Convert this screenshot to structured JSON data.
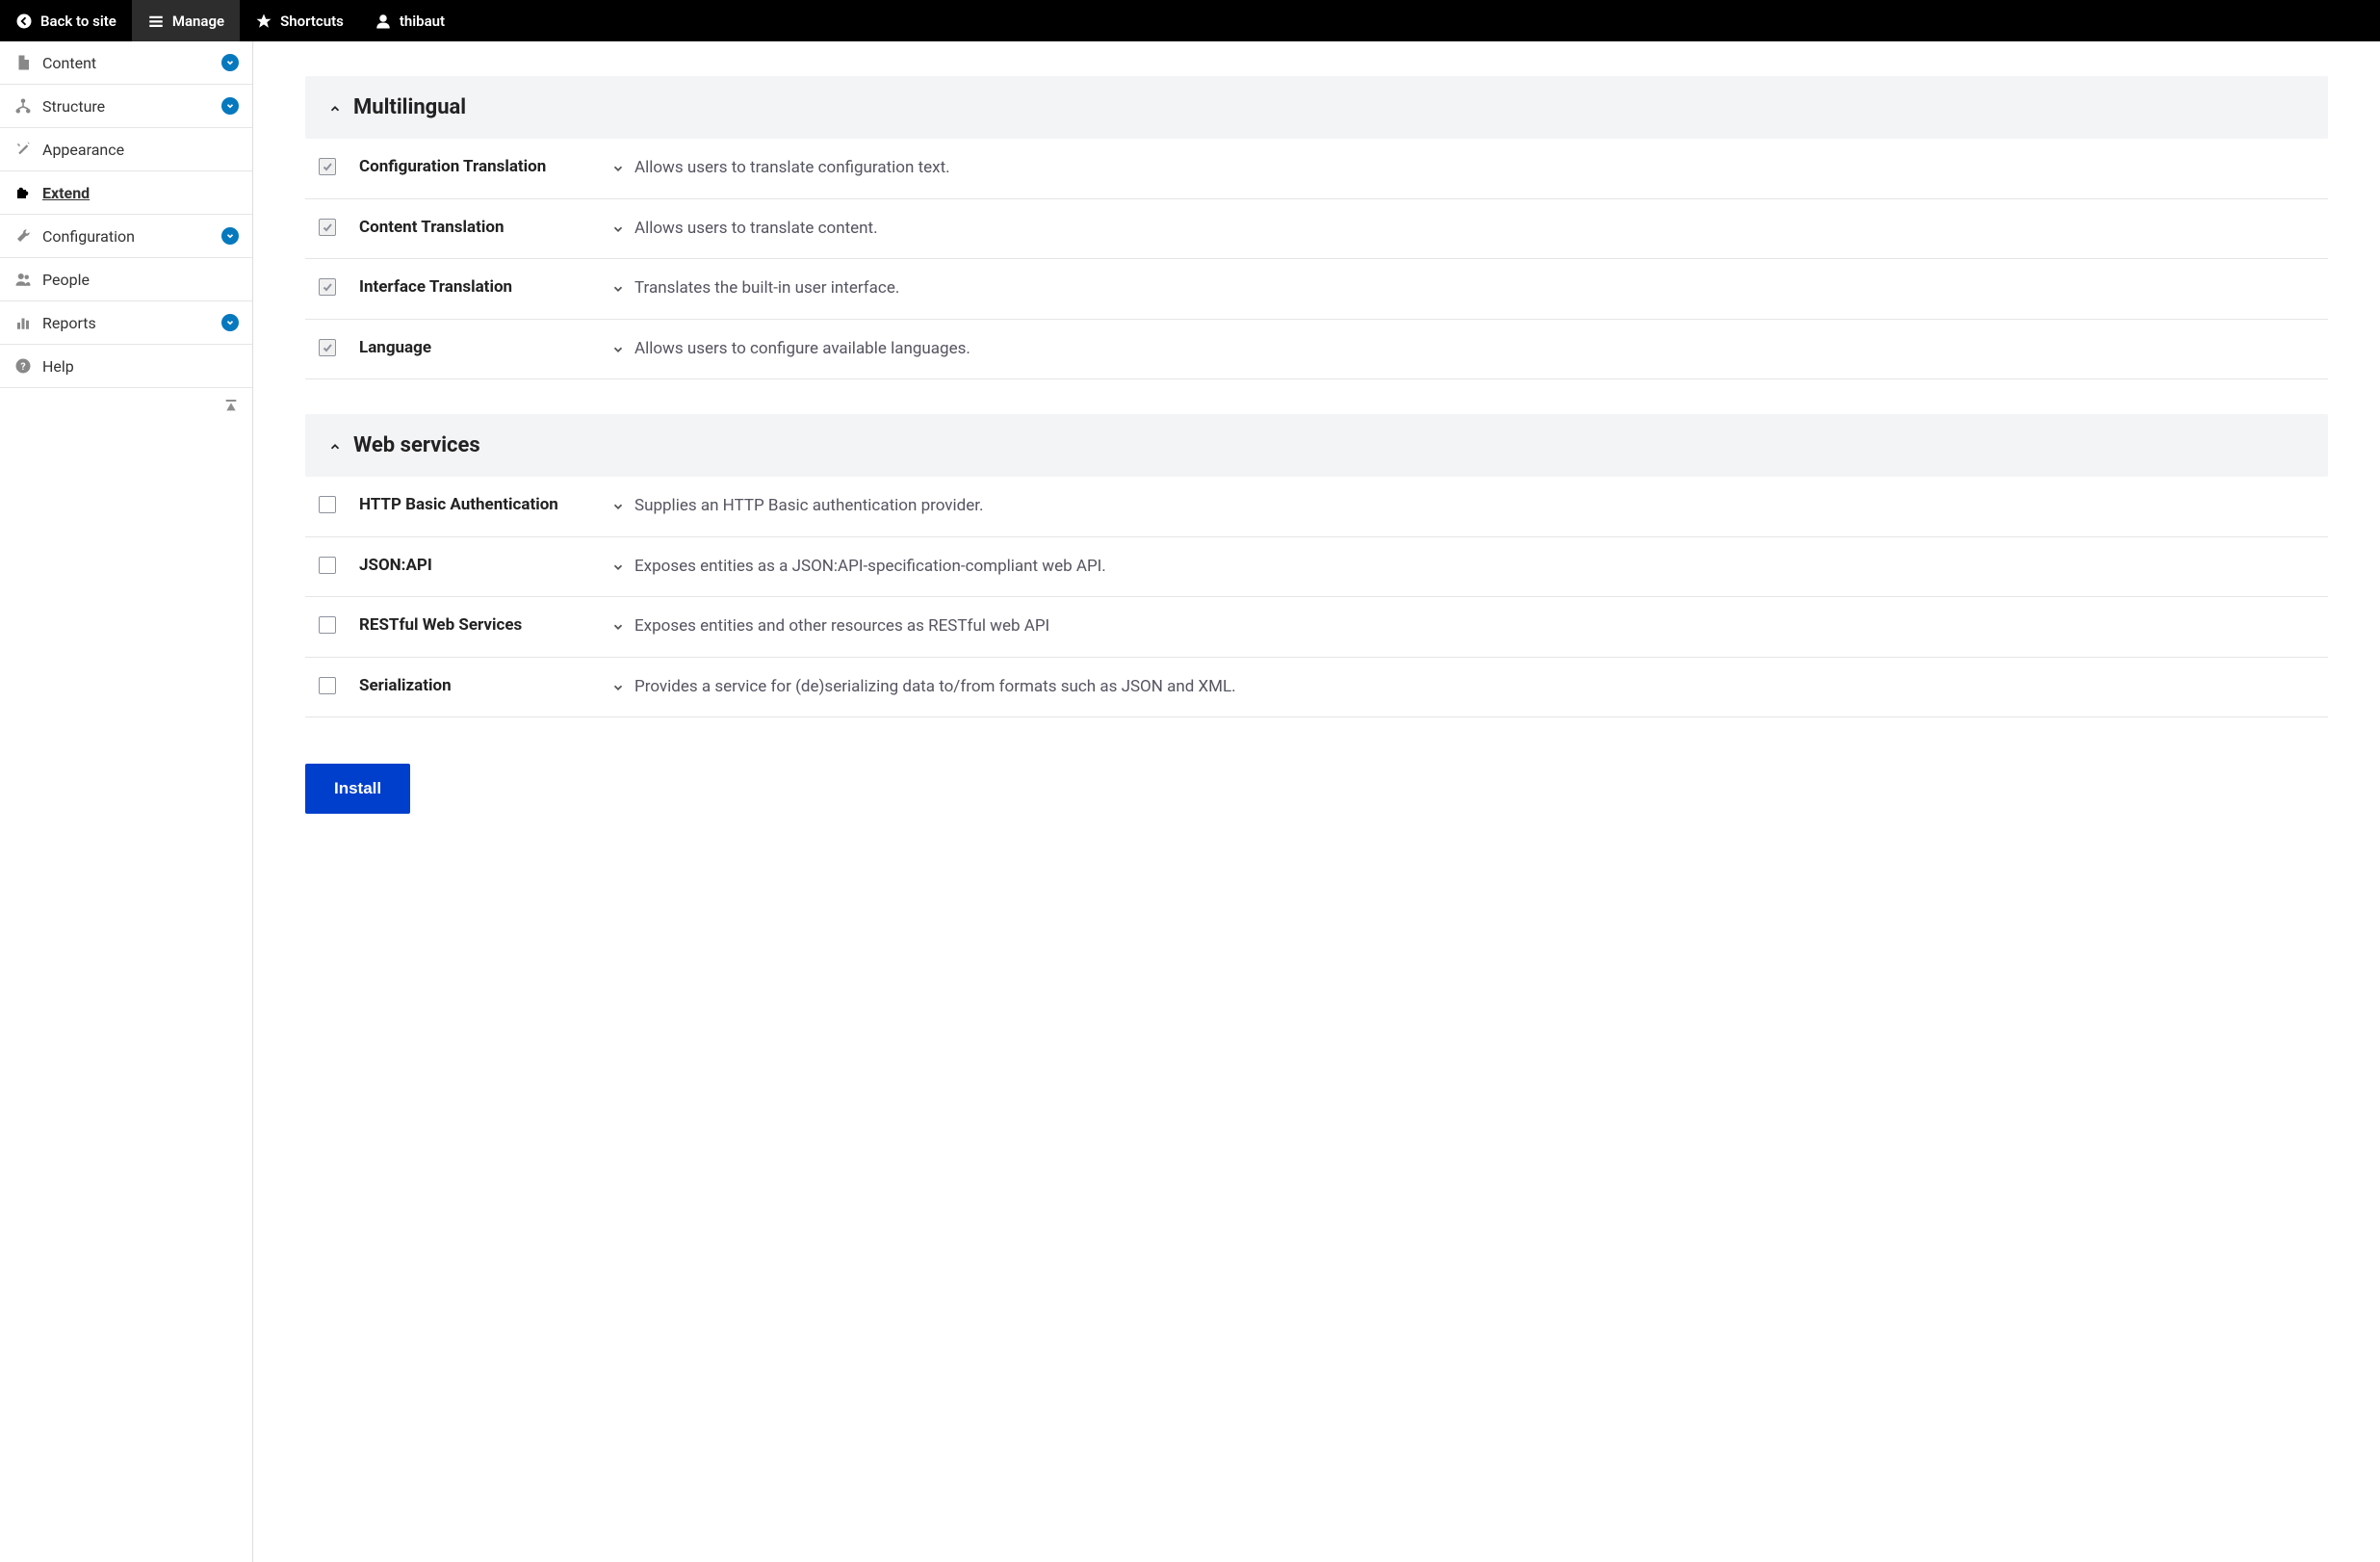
{
  "topbar": {
    "back": "Back to site",
    "manage": "Manage",
    "shortcuts": "Shortcuts",
    "user": "thibaut"
  },
  "sidebar": {
    "items": [
      {
        "label": "Content",
        "icon": "file",
        "expandable": true
      },
      {
        "label": "Structure",
        "icon": "hierarchy",
        "expandable": true
      },
      {
        "label": "Appearance",
        "icon": "wand",
        "expandable": false
      },
      {
        "label": "Extend",
        "icon": "puzzle",
        "expandable": false,
        "active": true
      },
      {
        "label": "Configuration",
        "icon": "wrench",
        "expandable": true
      },
      {
        "label": "People",
        "icon": "people",
        "expandable": false
      },
      {
        "label": "Reports",
        "icon": "bars",
        "expandable": true
      },
      {
        "label": "Help",
        "icon": "help",
        "expandable": false
      }
    ]
  },
  "sections": [
    {
      "title": "Multilingual",
      "modules": [
        {
          "name": "Configuration Translation",
          "desc": "Allows users to translate configuration text.",
          "checked": true,
          "disabled": true
        },
        {
          "name": "Content Translation",
          "desc": "Allows users to translate content.",
          "checked": true,
          "disabled": true
        },
        {
          "name": "Interface Translation",
          "desc": "Translates the built-in user interface.",
          "checked": true,
          "disabled": true
        },
        {
          "name": "Language",
          "desc": "Allows users to configure available languages.",
          "checked": true,
          "disabled": true
        }
      ]
    },
    {
      "title": "Web services",
      "modules": [
        {
          "name": "HTTP Basic Authentication",
          "desc": "Supplies an HTTP Basic authentication provider.",
          "checked": false,
          "disabled": false
        },
        {
          "name": "JSON:API",
          "desc": "Exposes entities as a JSON:API-specification-compliant web API.",
          "checked": false,
          "disabled": false
        },
        {
          "name": "RESTful Web Services",
          "desc": "Exposes entities and other resources as RESTful web API",
          "checked": false,
          "disabled": false
        },
        {
          "name": "Serialization",
          "desc": "Provides a service for (de)serializing data to/from formats such as JSON and XML.",
          "checked": false,
          "disabled": false
        }
      ]
    }
  ],
  "button": {
    "install": "Install"
  }
}
